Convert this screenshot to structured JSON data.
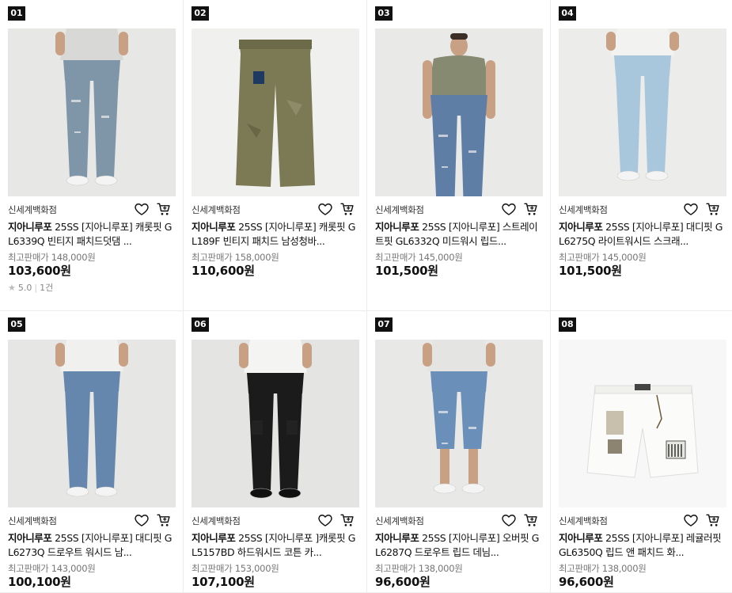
{
  "products": [
    {
      "rank": "01",
      "store": "신세계백화점",
      "brand": "지아니루포",
      "name": " 25SS [지아니루포] 캐롯핏 GL6339Q 빈티지 패치드덧댐 ...",
      "original_price": "최고판매가 148,000원",
      "price": "103,600원",
      "rating": "5.0",
      "review_count": "1건",
      "image": "man-light-wash-ripped-jeans-photo"
    },
    {
      "rank": "02",
      "store": "신세계백화점",
      "brand": "지아니루포",
      "name": " 25SS [지아니루포] 캐롯핏 GL189F 빈티지 패치드 남성청바...",
      "original_price": "최고판매가 158,000원",
      "price": "110,600원",
      "image": "olive-pants-flat-photo"
    },
    {
      "rank": "03",
      "store": "신세계백화점",
      "brand": "지아니루포",
      "name": " 25SS [지아니루포] 스트레이트핏 GL6332Q 미드워시 립드...",
      "original_price": "최고판매가 145,000원",
      "price": "101,500원",
      "image": "man-olive-tshirt-straight-jeans-photo"
    },
    {
      "rank": "04",
      "store": "신세계백화점",
      "brand": "지아니루포",
      "name": " 25SS [지아니루포] 대디핏 GL6275Q 라이트워시드 스크래...",
      "original_price": "최고판매가 145,000원",
      "price": "101,500원",
      "image": "man-light-blue-jeans-photo"
    },
    {
      "rank": "05",
      "store": "신세계백화점",
      "brand": "지아니루포",
      "name": " 25SS [지아니루포] 대디핏 GL6273Q 드로우트 워시드 남...",
      "original_price": "최고판매가 143,000원",
      "price": "100,100원",
      "image": "man-mid-blue-jeans-photo"
    },
    {
      "rank": "06",
      "store": "신세계백화점",
      "brand": "지아니루포",
      "name": " 25SS [지아니루포 ]캐롯핏 GL5157BD 하드워시드 코튼 카...",
      "original_price": "최고판매가 153,000원",
      "price": "107,100원",
      "image": "man-black-cargo-pants-photo"
    },
    {
      "rank": "07",
      "store": "신세계백화점",
      "brand": "지아니루포",
      "name": " 25SS [지아니루포] 오버핏 GL6287Q 드로우트 립드 데님...",
      "original_price": "최고판매가 138,000원",
      "price": "96,600원",
      "image": "man-denim-shorts-photo"
    },
    {
      "rank": "08",
      "store": "신세계백화점",
      "brand": "지아니루포",
      "name": " 25SS [지아니루포] 레귤러핏 GL6350Q 립드 앤 패치드 화...",
      "original_price": "최고판매가 138,000원",
      "price": "96,600원",
      "image": "white-patched-shorts-flat-photo"
    }
  ],
  "icons": {
    "wishlist": "heart-icon",
    "cart": "cart-icon",
    "rating": "star-icon"
  },
  "colors": {
    "rank_badge_bg": "#111111",
    "price": "#111111",
    "muted": "#777777",
    "divider": "#ececec"
  }
}
